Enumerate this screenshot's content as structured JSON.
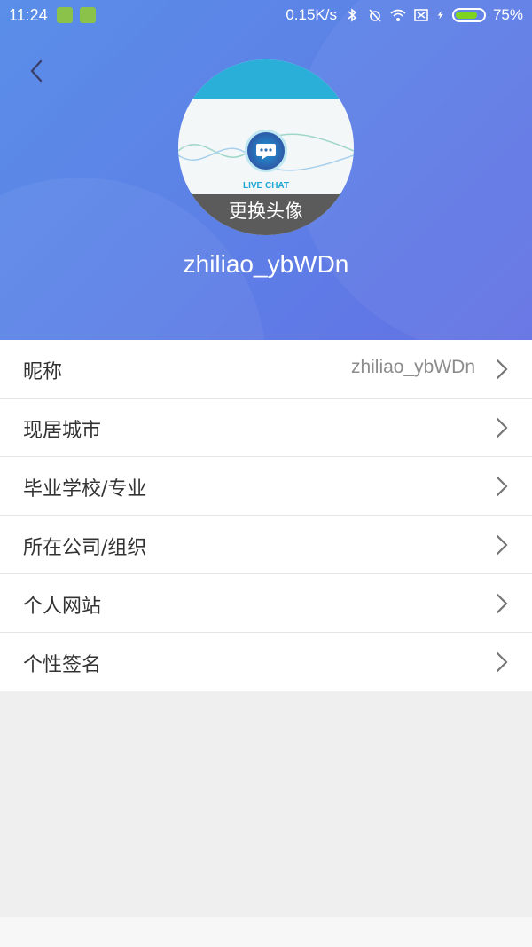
{
  "status_bar": {
    "time": "11:24",
    "network_speed": "0.15K/s",
    "battery_percent": "75%",
    "battery_level": 0.75,
    "icons": [
      "battery-app-icon",
      "android-app-icon",
      "bluetooth-icon",
      "alarm-off-icon",
      "wifi-icon",
      "sim-off-icon",
      "charging-icon",
      "battery-icon"
    ]
  },
  "header": {
    "avatar_change_label": "更换头像",
    "avatar_brand_text": "LIVE CHAT",
    "username": "zhiliao_ybWDn",
    "colors": {
      "gradient_start": "#5a8ee8",
      "gradient_end": "#6371e4"
    }
  },
  "profile_items": [
    {
      "label": "昵称",
      "value": "zhiliao_ybWDn"
    },
    {
      "label": "现居城市",
      "value": ""
    },
    {
      "label": "毕业学校/专业",
      "value": ""
    },
    {
      "label": "所在公司/组织",
      "value": ""
    },
    {
      "label": "个人网站",
      "value": ""
    },
    {
      "label": "个性签名",
      "value": ""
    }
  ]
}
